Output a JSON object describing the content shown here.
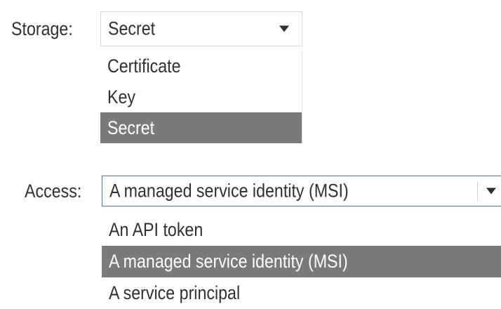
{
  "storage": {
    "label": "Storage:",
    "selected": "Secret",
    "options": [
      {
        "label": "Certificate",
        "selected": false
      },
      {
        "label": "Key",
        "selected": false
      },
      {
        "label": "Secret",
        "selected": true
      }
    ]
  },
  "access": {
    "label": "Access:",
    "selected": "A managed service identity (MSI)",
    "options": [
      {
        "label": "An API token",
        "selected": false
      },
      {
        "label": "A managed service identity (MSI)",
        "selected": true
      },
      {
        "label": "A service principal",
        "selected": false
      }
    ]
  },
  "colors": {
    "highlight": "#7a7a7a",
    "focus_border": "#4a78b0"
  }
}
